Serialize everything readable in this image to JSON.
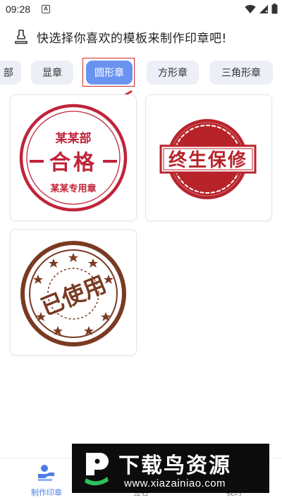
{
  "status": {
    "time": "09:28",
    "notification_icon": "a-letter-icon",
    "icons": [
      "wifi-icon",
      "signal-icon",
      "battery-icon"
    ]
  },
  "header": {
    "icon": "stamp-icon",
    "title": "快选择你喜欢的模板来制作印章吧!"
  },
  "tabs": [
    {
      "label": "部",
      "active": false
    },
    {
      "label": "显章",
      "active": false
    },
    {
      "label": "圆形章",
      "active": true
    },
    {
      "label": "方形章",
      "active": false
    },
    {
      "label": "三角形章",
      "active": false
    }
  ],
  "templates": [
    {
      "name": "round-stamp-qualified",
      "top": "某某部",
      "middle": "合格",
      "bottom": "某某专用章",
      "color": "#c0243a"
    },
    {
      "name": "lifetime-warranty-stamp",
      "middle": "终生保修",
      "color": "#b8232a"
    },
    {
      "name": "used-stamp",
      "middle": "已使用",
      "color": "#7a3a22"
    }
  ],
  "bottom_nav": [
    {
      "label": "制作印章",
      "icon": "hand-stamp-icon",
      "active": true
    },
    {
      "label": "签名",
      "icon": "signature-icon",
      "active": false
    },
    {
      "label": "我的",
      "icon": "user-icon",
      "active": false
    }
  ],
  "watermark": {
    "title": "下载鸟资源",
    "url": "www.xiazainiao.com"
  },
  "colors": {
    "accent": "#6a93f0",
    "tab_bg": "#eceff5",
    "highlight": "#d32a2a"
  }
}
